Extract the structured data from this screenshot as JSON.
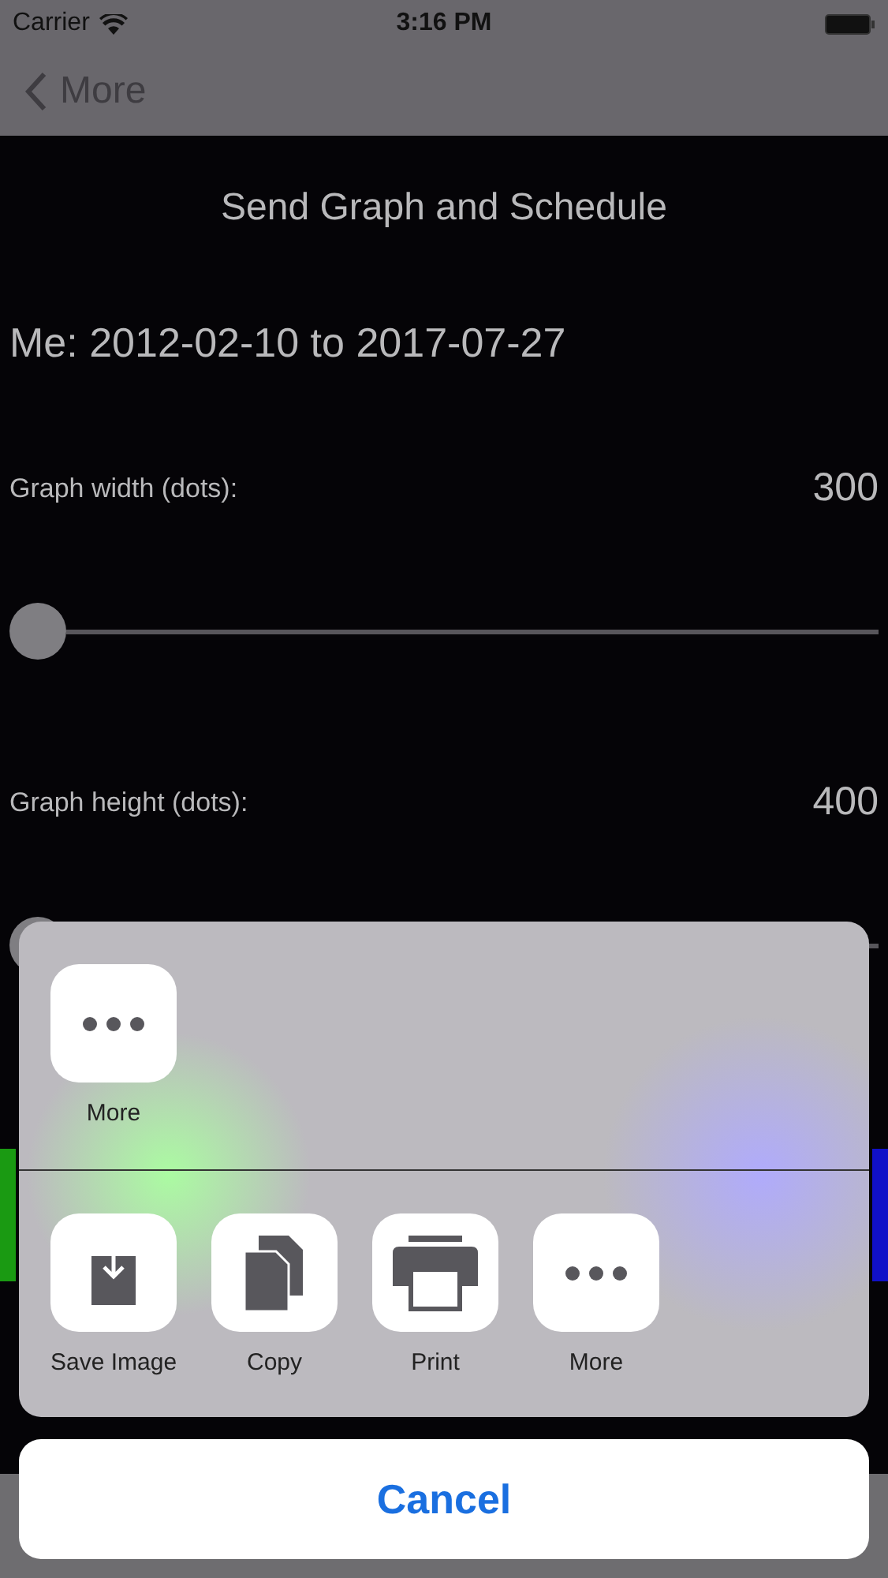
{
  "status_bar": {
    "carrier": "Carrier",
    "time": "3:16 PM"
  },
  "nav_bar": {
    "back_label": "More"
  },
  "title": "Send Graph and Schedule",
  "date_range": "Me: 2012-02-10 to 2017-07-27",
  "settings": [
    {
      "label": "Graph width (dots):",
      "value": "300",
      "level": 0
    },
    {
      "label": "Graph height (dots):",
      "value": "400",
      "level": 0
    }
  ],
  "share_sheet": {
    "top_row": [
      {
        "kind": "more",
        "label": "More"
      }
    ],
    "bottom_row": [
      {
        "kind": "save",
        "label": "Save Image"
      },
      {
        "kind": "copy",
        "label": "Copy"
      },
      {
        "kind": "print",
        "label": "Print"
      },
      {
        "kind": "more",
        "label": "More"
      }
    ],
    "cancel": "Cancel"
  }
}
